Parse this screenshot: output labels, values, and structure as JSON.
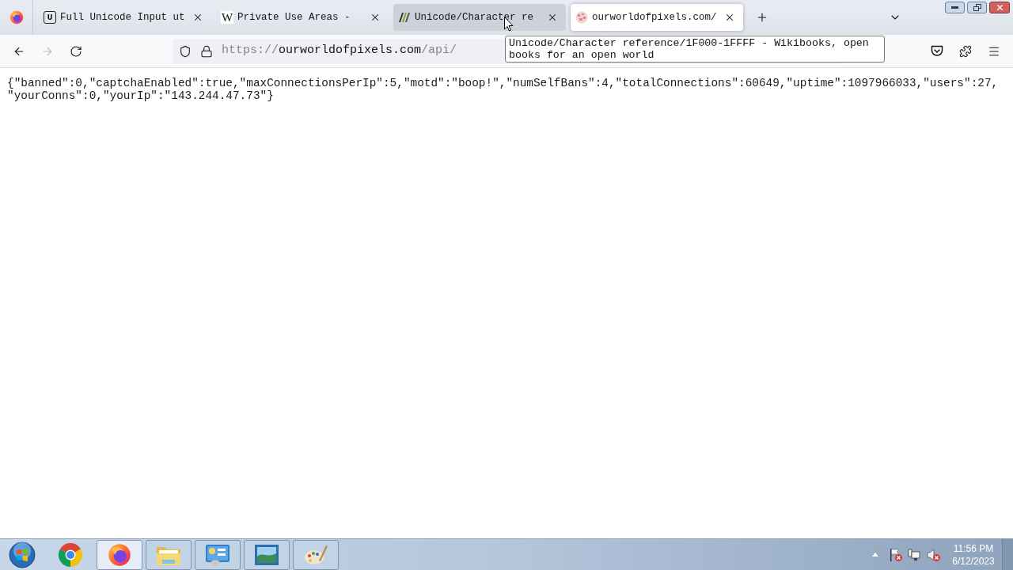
{
  "tabs": [
    {
      "title": "Full Unicode Input ut",
      "kind": "boxed-letter",
      "icon_text": "U",
      "selected": false,
      "hovered": false
    },
    {
      "title": "Private Use Areas -",
      "kind": "letter",
      "icon_text": "W",
      "selected": false,
      "hovered": false
    },
    {
      "title": "Unicode/Character re",
      "kind": "books",
      "selected": false,
      "hovered": true
    },
    {
      "title": "ourworldofpixels.com/",
      "kind": "globe",
      "selected": true,
      "hovered": false
    }
  ],
  "navigation": {
    "forward_disabled": true
  },
  "address_bar": {
    "scheme": "https://",
    "host": "ourworldofpixels.com",
    "path": "/api/"
  },
  "tooltip": {
    "text": "Unicode/Character reference/1F000-1FFFF - Wikibooks, open books for an open world"
  },
  "page": {
    "json_text": "{\"banned\":0,\"captchaEnabled\":true,\"maxConnectionsPerIp\":5,\"motd\":\"boop!\",\"numSelfBans\":4,\"totalConnections\":60649,\"uptime\":1097966033,\"users\":27,\"yourConns\":0,\"yourIp\":\"143.244.47.73\"}"
  },
  "taskbar": {
    "apps": [
      {
        "kind": "chrome",
        "running": false,
        "active": false
      },
      {
        "kind": "firefox",
        "running": true,
        "active": true
      },
      {
        "kind": "folder",
        "running": true,
        "active": false
      },
      {
        "kind": "panel",
        "running": true,
        "active": false
      },
      {
        "kind": "photo",
        "running": true,
        "active": false
      },
      {
        "kind": "paint",
        "running": true,
        "active": false
      }
    ],
    "clock": {
      "time": "11:56 PM",
      "date": "6/12/2023"
    }
  }
}
